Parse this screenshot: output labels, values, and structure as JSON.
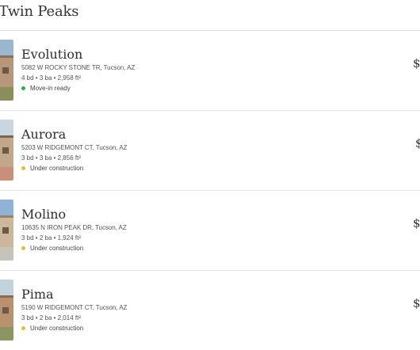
{
  "header": {
    "title": "t Twin Peaks"
  },
  "colors": {
    "move_in_ready": "#22b24c",
    "under_construction": "#e2c02c",
    "divider": "#e3e3e3"
  },
  "listings": [
    {
      "name": "Evolution",
      "address": "5082 W ROCKY STONE TR, Tucson, AZ",
      "specs": "4 bd • 3 ba • 2,958 ft²",
      "status": "Move-in ready",
      "price": "$"
    },
    {
      "name": "Aurora",
      "address": "5203 W RIDGEMONT CT, Tucson, AZ",
      "specs": "3 bd • 3 ba • 2,856 ft²",
      "status": "Under construction",
      "price": "$"
    },
    {
      "name": "Molino",
      "address": "10635 N IRON PEAK DR, Tucson, AZ",
      "specs": "3 bd • 2 ba • 1,924 ft²",
      "status": "Under construction",
      "price": "$"
    },
    {
      "name": "Pima",
      "address": "5190 W RIDGEMONT CT, Tucson, AZ",
      "specs": "3 bd • 2 ba • 2,014 ft²",
      "status": "Under construction",
      "price": "$"
    }
  ]
}
